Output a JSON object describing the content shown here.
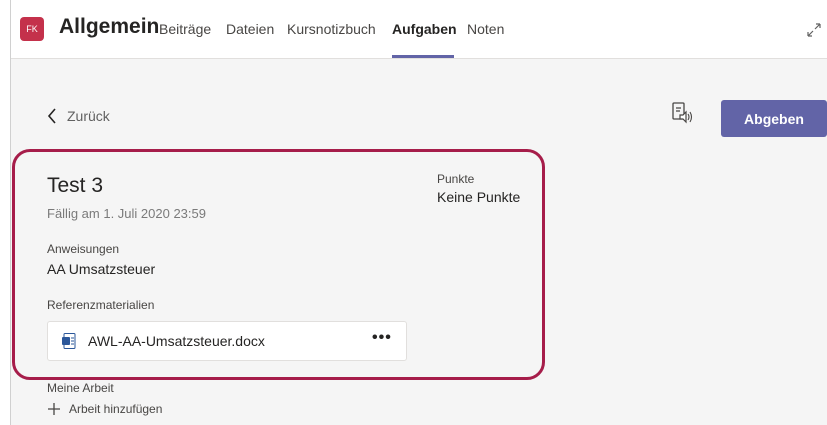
{
  "header": {
    "team_initials": "FK",
    "channel_name": "Allgemein",
    "tabs": [
      {
        "label": "Beiträge"
      },
      {
        "label": "Dateien"
      },
      {
        "label": "Kursnotizbuch"
      },
      {
        "label": "Aufgaben"
      },
      {
        "label": "Noten"
      }
    ],
    "active_tab": "Aufgaben"
  },
  "nav": {
    "back_label": "Zurück"
  },
  "actions": {
    "submit_label": "Abgeben"
  },
  "assignment": {
    "title": "Test 3",
    "due": "Fällig am 1. Juli 2020 23:59",
    "points_label": "Punkte",
    "points_value": "Keine Punkte",
    "instructions_label": "Anweisungen",
    "instructions": "AA Umsatzsteuer",
    "references_label": "Referenzmaterialien",
    "reference_file": "AWL-AA-Umsatzsteuer.docx",
    "more_label": "•••",
    "my_work_label": "Meine Arbeit",
    "add_work_label": "Arbeit hinzufügen"
  },
  "colors": {
    "accent": "#6264a7",
    "team_avatar": "#c4314b",
    "highlight_border": "#a61d4a",
    "word_icon": "#2b579a"
  }
}
